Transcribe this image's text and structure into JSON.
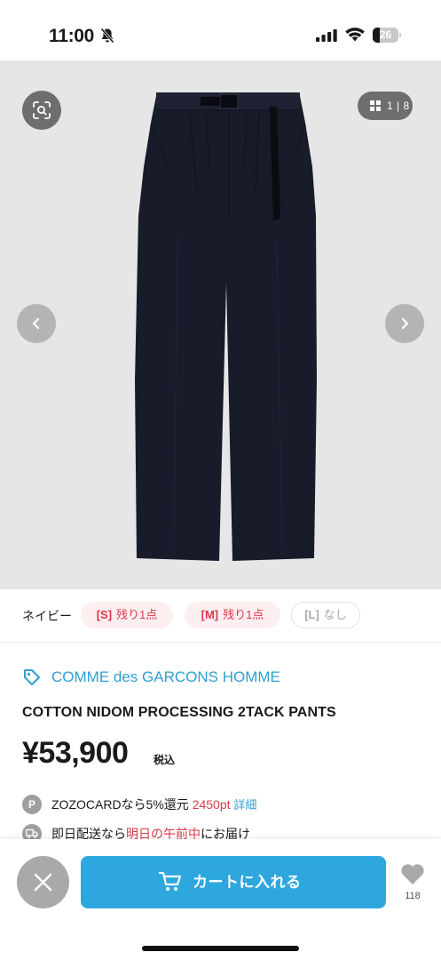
{
  "status_bar": {
    "time": "11:00",
    "battery_level": "26",
    "icons": [
      "bell-slash-icon",
      "signal-icon",
      "wifi-icon",
      "battery-icon"
    ]
  },
  "gallery": {
    "counter": "1 | 8",
    "current_index": 1,
    "total": 8,
    "background_color": "#e6e6e6",
    "item_color": "#171b2a",
    "icons": [
      "zoom-search-icon",
      "grid-icon",
      "chevron-left-icon",
      "chevron-right-icon"
    ]
  },
  "variants": {
    "color_name": "ネイビー",
    "sizes": [
      {
        "size": "[S]",
        "stock": "残り1点",
        "available": true
      },
      {
        "size": "[M]",
        "stock": "残り1点",
        "available": true
      },
      {
        "size": "[L]",
        "stock": "なし",
        "available": false
      }
    ]
  },
  "product": {
    "brand": "COMME des GARCONS HOMME",
    "title": "COTTON NIDOM PROCESSING 2TACK PANTS",
    "price": "¥53,900",
    "tax_label": "税込"
  },
  "info": {
    "points": {
      "badge": "P",
      "text": "ZOZOCARDなら5%還元",
      "points_value": "2450pt",
      "link": "詳細"
    },
    "delivery": {
      "text_before": "即日配送なら",
      "highlight": "明日の午前中",
      "text_after": "にお届け"
    }
  },
  "actions": {
    "close_icon": "close-icon",
    "cart_label": "カートに入れる",
    "cart_icon": "cart-icon",
    "favorite_count": "118",
    "favorite_icon": "heart-icon"
  },
  "colors": {
    "accent_blue": "#2ea7df",
    "brand_blue": "#2f9fd1",
    "stock_red": "#d93a4a",
    "button_gray": "#a9a9a9"
  }
}
